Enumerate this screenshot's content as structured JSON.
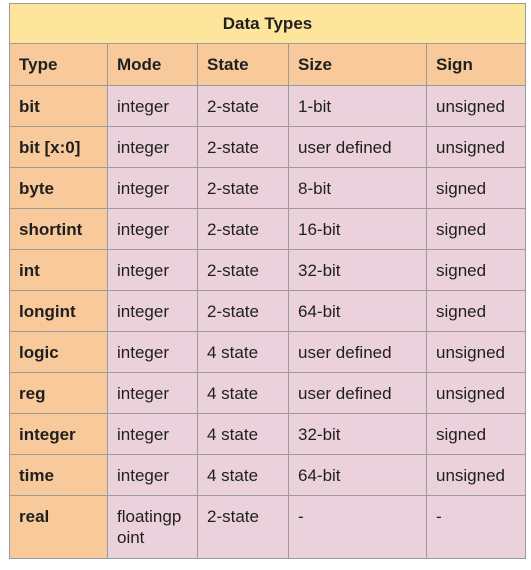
{
  "table": {
    "title": "Data Types",
    "headers": [
      "Type",
      "Mode",
      "State",
      "Size",
      "Sign"
    ],
    "rows": [
      [
        "bit",
        "integer",
        "2-state",
        "1-bit",
        "unsigned"
      ],
      [
        "bit [x:0]",
        "integer",
        "2-state",
        "user defined",
        "unsigned"
      ],
      [
        "byte",
        "integer",
        "2-state",
        "8-bit",
        "signed"
      ],
      [
        "shortint",
        "integer",
        "2-state",
        "16-bit",
        "signed"
      ],
      [
        "int",
        "integer",
        "2-state",
        "32-bit",
        "signed"
      ],
      [
        "longint",
        "integer",
        "2-state",
        "64-bit",
        "signed"
      ],
      [
        "logic",
        "integer",
        "4 state",
        "user defined",
        "unsigned"
      ],
      [
        "reg",
        "integer",
        "4 state",
        "user defined",
        "unsigned"
      ],
      [
        "integer",
        "integer",
        "4 state",
        "32-bit",
        "signed"
      ],
      [
        "time",
        "integer",
        "4 state",
        "64-bit",
        "unsigned"
      ],
      [
        "real",
        "floatingp oint",
        "2-state",
        "-",
        "-"
      ]
    ]
  },
  "colors": {
    "title_bg": "#fde59b",
    "header_bg": "#f8c99b",
    "type_col_bg": "#f8c99b",
    "cell_bg": "#ead1dc",
    "border": "#9a9a9a"
  }
}
